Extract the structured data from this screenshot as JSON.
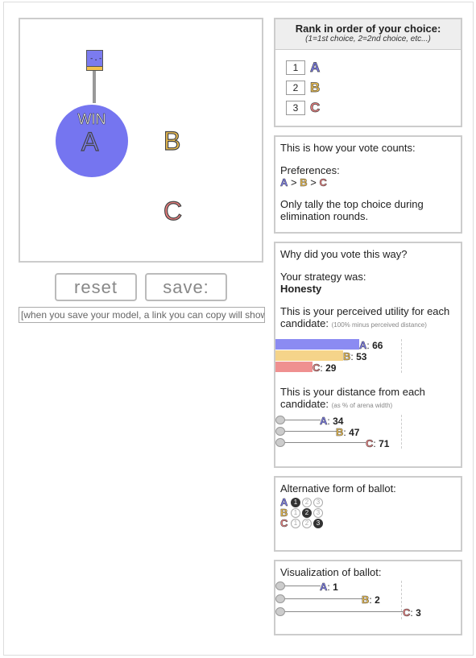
{
  "arena": {
    "win_label": "WIN",
    "voter_face": "-.-",
    "candidates": [
      {
        "id": "a",
        "letter": "A",
        "color": "#7b7bef"
      },
      {
        "id": "b",
        "letter": "B",
        "color": "#f2c14e"
      },
      {
        "id": "c",
        "letter": "C",
        "color": "#e87c7c"
      }
    ]
  },
  "controls": {
    "reset_label": "reset",
    "save_label": "save:",
    "link_field_value": "[when you save your model, a link you can copy will show up here]"
  },
  "rank_panel": {
    "title": "Rank in order of your choice:",
    "subtitle": "(1=1st choice, 2=2nd choice, etc...)",
    "rows": [
      {
        "rank": "1",
        "letter": "A"
      },
      {
        "rank": "2",
        "letter": "B"
      },
      {
        "rank": "3",
        "letter": "C"
      }
    ]
  },
  "count_panel": {
    "intro": "This is how your vote counts:",
    "preferences_label": "Preferences:",
    "pref_a": "A",
    "pref_sep1": ">",
    "pref_b": "B",
    "pref_sep2": ">",
    "pref_c": "C",
    "note": "Only tally the top choice during elimination rounds."
  },
  "why_panel": {
    "question": "Why did you vote this way?",
    "strategy_label": "Your strategy was:",
    "strategy_value": "Honesty",
    "utility_label": "This is your perceived utility for each candidate:",
    "utility_note": "(100% minus perceived distance)",
    "utilities": [
      {
        "letter": "A",
        "value": "66"
      },
      {
        "letter": "B",
        "value": "53"
      },
      {
        "letter": "C",
        "value": "29"
      }
    ],
    "distance_label": "This is your distance from each candidate:",
    "distance_note": "(as % of arena width)",
    "distances": [
      {
        "letter": "A",
        "value": "34"
      },
      {
        "letter": "B",
        "value": "47"
      },
      {
        "letter": "C",
        "value": "71"
      }
    ]
  },
  "alt_panel": {
    "title": "Alternative form of ballot:",
    "rows": [
      {
        "letter": "A",
        "marks": [
          "1",
          "2",
          "3"
        ],
        "filled": 1
      },
      {
        "letter": "B",
        "marks": [
          "1",
          "2",
          "3"
        ],
        "filled": 2
      },
      {
        "letter": "C",
        "marks": [
          "1",
          "2",
          "3"
        ],
        "filled": 3
      }
    ]
  },
  "vis_panel": {
    "title": "Visualization of ballot:",
    "rows": [
      {
        "letter": "A",
        "value": "1"
      },
      {
        "letter": "B",
        "value": "2"
      },
      {
        "letter": "C",
        "value": "3"
      }
    ]
  }
}
